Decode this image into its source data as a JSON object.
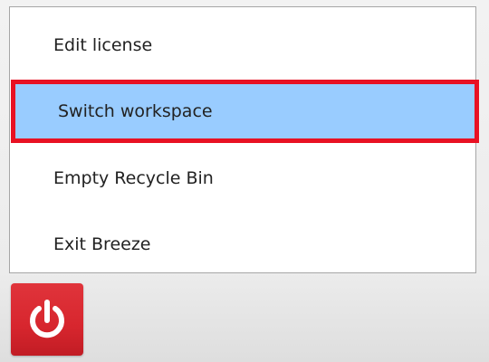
{
  "menu": {
    "items": [
      {
        "label": "Edit license",
        "highlighted": false
      },
      {
        "label": "Switch workspace",
        "highlighted": true
      },
      {
        "label": "Empty Recycle Bin",
        "highlighted": false
      },
      {
        "label": "Exit Breeze",
        "highlighted": false
      }
    ]
  },
  "colors": {
    "highlight_fill": "#99ccff",
    "highlight_border": "#e81123",
    "power_tile": "#d7262e",
    "power_glyph": "#ffffff"
  },
  "power_button": {
    "icon": "power-icon"
  }
}
